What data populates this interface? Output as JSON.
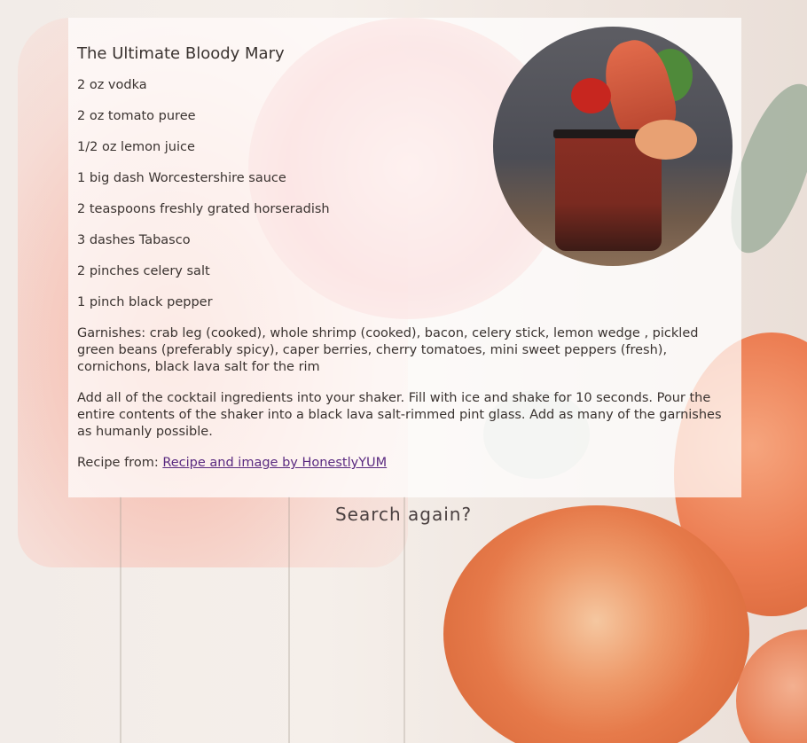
{
  "recipe": {
    "title": "The Ultimate Bloody Mary",
    "ingredients": [
      "2 oz vodka",
      "2 oz tomato puree",
      "1/2 oz lemon juice",
      "1 big dash Worcestershire sauce",
      "2 teaspoons freshly grated horseradish",
      "3 dashes Tabasco",
      "2 pinches celery salt",
      "1 pinch black pepper"
    ],
    "garnishes": "Garnishes: crab leg (cooked), whole shrimp (cooked), bacon, celery stick, lemon wedge , pickled green beans (preferably spicy), caper berries, cherry tomatoes, mini sweet peppers (fresh), cornichons, black lava salt for the rim",
    "instructions": "Add all of the cocktail ingredients into your shaker. Fill with ice and shake for 10 seconds. Pour the entire contents of the shaker into a black lava salt-rimmed pint glass. Add as many of the garnishes as humanly possible.",
    "source_label": "Recipe from: ",
    "source_link_text": "Recipe and image by HonestlyYUM"
  },
  "search_again_label": "Search again?",
  "colors": {
    "text": "#3a3330",
    "link": "#5a2a80",
    "card_background": "rgba(255,255,255,0.72)"
  }
}
